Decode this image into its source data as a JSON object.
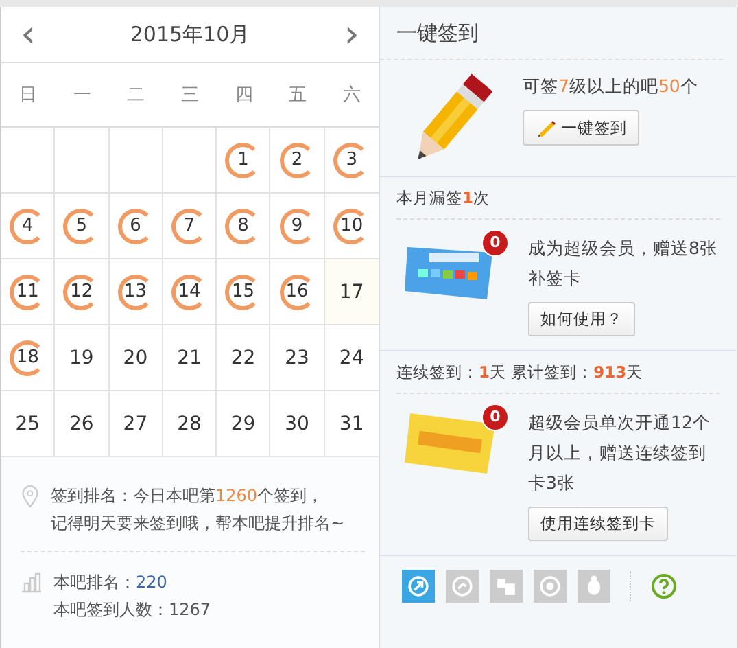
{
  "calendar": {
    "title": "2015年10月",
    "prev": "‹",
    "next": "›",
    "weekdays": [
      "日",
      "一",
      "二",
      "三",
      "四",
      "五",
      "六"
    ],
    "days": [
      {
        "kind": "empty"
      },
      {
        "kind": "empty"
      },
      {
        "kind": "empty"
      },
      {
        "kind": "empty"
      },
      {
        "kind": "day",
        "day": "1",
        "signed": true,
        "today": false
      },
      {
        "kind": "day",
        "day": "2",
        "signed": true,
        "today": false
      },
      {
        "kind": "day",
        "day": "3",
        "signed": true,
        "today": false
      },
      {
        "kind": "day",
        "day": "4",
        "signed": true,
        "today": false
      },
      {
        "kind": "day",
        "day": "5",
        "signed": true,
        "today": false
      },
      {
        "kind": "day",
        "day": "6",
        "signed": true,
        "today": false
      },
      {
        "kind": "day",
        "day": "7",
        "signed": true,
        "today": false
      },
      {
        "kind": "day",
        "day": "8",
        "signed": true,
        "today": false
      },
      {
        "kind": "day",
        "day": "9",
        "signed": true,
        "today": false
      },
      {
        "kind": "day",
        "day": "10",
        "signed": true,
        "today": false
      },
      {
        "kind": "day",
        "day": "11",
        "signed": true,
        "today": false
      },
      {
        "kind": "day",
        "day": "12",
        "signed": true,
        "today": false
      },
      {
        "kind": "day",
        "day": "13",
        "signed": true,
        "today": false
      },
      {
        "kind": "day",
        "day": "14",
        "signed": true,
        "today": false
      },
      {
        "kind": "day",
        "day": "15",
        "signed": true,
        "today": false
      },
      {
        "kind": "day",
        "day": "16",
        "signed": true,
        "today": false
      },
      {
        "kind": "day",
        "day": "17",
        "signed": false,
        "today": true
      },
      {
        "kind": "day",
        "day": "18",
        "signed": true,
        "today": false
      },
      {
        "kind": "day",
        "day": "19",
        "signed": false,
        "today": false
      },
      {
        "kind": "day",
        "day": "20",
        "signed": false,
        "today": false
      },
      {
        "kind": "day",
        "day": "21",
        "signed": false,
        "today": false
      },
      {
        "kind": "day",
        "day": "22",
        "signed": false,
        "today": false
      },
      {
        "kind": "day",
        "day": "23",
        "signed": false,
        "today": false
      },
      {
        "kind": "day",
        "day": "24",
        "signed": false,
        "today": false
      },
      {
        "kind": "day",
        "day": "25",
        "signed": false,
        "today": false
      },
      {
        "kind": "day",
        "day": "26",
        "signed": false,
        "today": false
      },
      {
        "kind": "day",
        "day": "27",
        "signed": false,
        "today": false
      },
      {
        "kind": "day",
        "day": "28",
        "signed": false,
        "today": false
      },
      {
        "kind": "day",
        "day": "29",
        "signed": false,
        "today": false
      },
      {
        "kind": "day",
        "day": "30",
        "signed": false,
        "today": false
      },
      {
        "kind": "day",
        "day": "31",
        "signed": false,
        "today": false
      }
    ]
  },
  "ranking": {
    "lines": [
      [
        {
          "text": "签到排名：今日本吧第",
          "hl": false
        },
        {
          "text": "1260",
          "hl": true
        },
        {
          "text": "个签到，",
          "hl": false
        }
      ],
      [
        {
          "text": "记得明天要来签到哦，帮本吧提升排名~",
          "hl": false
        }
      ]
    ],
    "bar_rank_label": "本吧排名：",
    "bar_rank": "220",
    "signins": "本吧签到人数：1267"
  },
  "panel": {
    "title": "一键签到",
    "oneclick": {
      "text": [
        {
          "text": "可签",
          "hl": false
        },
        {
          "text": "7",
          "hl": true
        },
        {
          "text": "级以上的吧",
          "hl": false
        },
        {
          "text": "50",
          "hl": true
        },
        {
          "text": "个",
          "hl": false
        }
      ],
      "button": "一键签到"
    },
    "makeup": {
      "header": [
        {
          "text": "本月漏签",
          "hl": false
        },
        {
          "text": "1",
          "hl": true
        },
        {
          "text": "次",
          "hl": false
        }
      ],
      "badge": "0",
      "text": "成为超级会员，赠送8张补签卡",
      "button": "如何使用？"
    },
    "streak": {
      "header": [
        {
          "text": "连续签到：",
          "hl": false
        },
        {
          "text": "1",
          "hl": true
        },
        {
          "text": "天  累计签到：",
          "hl": false
        },
        {
          "text": "913",
          "hl": true
        },
        {
          "text": "天",
          "hl": false
        }
      ],
      "badge": "0",
      "text": "超级会员单次开通12个月以上，赠送连续签到卡3张",
      "button": "使用连续签到卡"
    },
    "tools": [
      {
        "selected": true
      },
      {
        "selected": false
      },
      {
        "selected": false
      },
      {
        "selected": false
      },
      {
        "selected": false
      }
    ]
  }
}
